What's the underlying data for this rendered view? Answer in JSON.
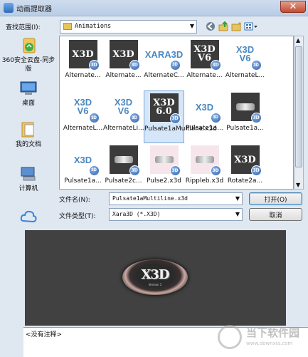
{
  "window": {
    "title": "动画提取器",
    "close_label": "✕"
  },
  "lookin": {
    "label": "查找范围(I):",
    "value": "Animations"
  },
  "toolbar": {
    "back_icon": "back-arrow-icon",
    "up_icon": "up-folder-icon",
    "newfolder_icon": "new-folder-icon",
    "view_icon": "view-menu-icon"
  },
  "places": [
    {
      "label": "360安全云盘-同步版",
      "icon": "cloud-drive-icon"
    },
    {
      "label": "桌面",
      "icon": "desktop-icon"
    },
    {
      "label": "我的文档",
      "icon": "documents-icon"
    },
    {
      "label": "计算机",
      "icon": "computer-icon"
    },
    {
      "label": "",
      "icon": "network-cloud-icon"
    }
  ],
  "files": [
    {
      "name": "Alternate...",
      "thumb": "dark",
      "text": "X3D"
    },
    {
      "name": "Alternate...",
      "thumb": "dark",
      "text": "X3D"
    },
    {
      "name": "AlternateC...",
      "thumb": "white",
      "text": "XARA3D"
    },
    {
      "name": "Alternate...",
      "thumb": "dark",
      "text": "X3D V6"
    },
    {
      "name": "AlternateL...",
      "thumb": "white",
      "text": "X3D V6"
    },
    {
      "name": "AlternateL...",
      "thumb": "white",
      "text": "X3D V6"
    },
    {
      "name": "AlternateLi...",
      "thumb": "white",
      "text": "X3D V6"
    },
    {
      "name": "Pulsate1aMultiline.x3d",
      "thumb": "dark",
      "text": "X3D 6.0",
      "selected": true
    },
    {
      "name": "Pulsate1a...",
      "thumb": "white",
      "text": "X3D"
    },
    {
      "name": "Pulsate1a...",
      "thumb": "dark",
      "text": ""
    },
    {
      "name": "Pulsate1a...",
      "thumb": "white",
      "text": "X3D"
    },
    {
      "name": "Pulsate2c...",
      "thumb": "dark",
      "text": ""
    },
    {
      "name": "Pulse2.x3d",
      "thumb": "pink",
      "text": ""
    },
    {
      "name": "Rippleb.x3d",
      "thumb": "pink",
      "text": ""
    },
    {
      "name": "Rotate2a...",
      "thumb": "dark",
      "text": "X3D"
    }
  ],
  "form": {
    "filename_label": "文件名(N):",
    "filename_value": "Pulsate1aMultiline.x3d",
    "filetype_label": "文件类型(T):",
    "filetype_value": "Xara3D (*.X3D)",
    "open_label": "打开(O)",
    "cancel_label": "取消"
  },
  "preview": {
    "logo_text": "X3D",
    "logo_sub": "Version 1"
  },
  "comment": {
    "text": "<没有注释>"
  },
  "watermark": {
    "text": "当下软件园",
    "url": "www.downxia.com"
  }
}
